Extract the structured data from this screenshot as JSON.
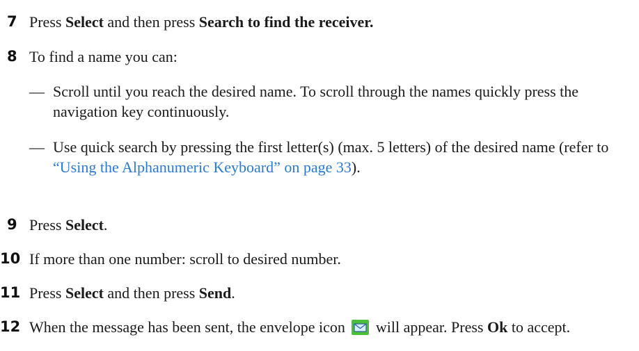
{
  "steps": [
    {
      "num": "7",
      "a": "Press ",
      "b1": "Select",
      "c": " and then press ",
      "b2": "Search",
      "d": " to find the receiver."
    },
    {
      "num": "8",
      "text": "To find a name you can:"
    },
    {
      "num": "9",
      "a": "Press ",
      "b1": "Select",
      "c": "."
    },
    {
      "num": "10",
      "text": "If more than one number: scroll to desired number."
    },
    {
      "num": "11",
      "a": "Press ",
      "b1": "Select",
      "c": " and then press ",
      "b2": "Send",
      "d": "."
    },
    {
      "num": "12",
      "a": "When the message has been sent, the envelope icon ",
      "c": " will appear. Press ",
      "b1": "Ok",
      "d": " to accept."
    }
  ],
  "sub_items": [
    {
      "dash": "—",
      "text": "Scroll until you reach the desired name. To scroll through the names quickly press the navigation key continuously."
    },
    {
      "dash": "—",
      "a": "Use quick search by pressing the first letter(s) (max. 5 letters) of the desired name (refer to ",
      "link": "“Using the Alphanumeric Keyboard” on page 33",
      "b": ")."
    }
  ],
  "icons": {
    "envelope": "envelope-icon"
  },
  "colors": {
    "link": "#2a7ad5",
    "envelope_bg": "#4cbf3a"
  }
}
